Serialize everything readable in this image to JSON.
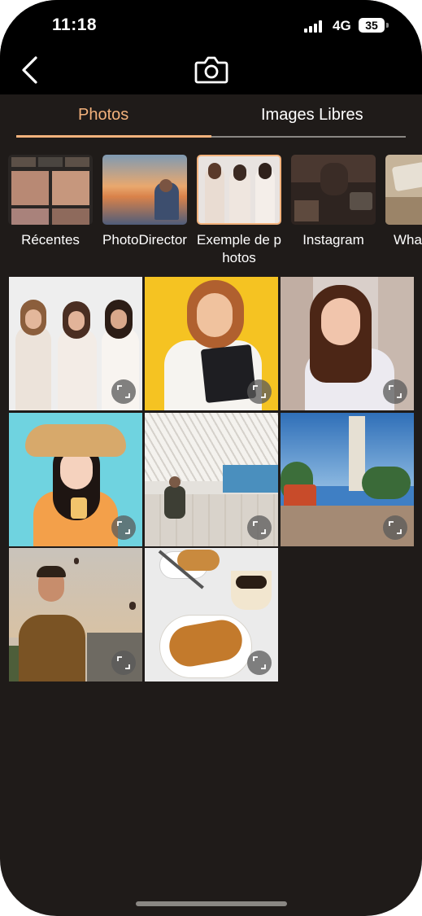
{
  "status_bar": {
    "time": "11:18",
    "network": "4G",
    "battery": "35"
  },
  "header": {
    "back_icon": "chevron-left-icon",
    "camera_icon": "camera-icon"
  },
  "tabs": [
    {
      "label": "Photos",
      "active": true
    },
    {
      "label": "Images Libres",
      "active": false
    }
  ],
  "albums": [
    {
      "label": "Récentes"
    },
    {
      "label": "PhotoDirector"
    },
    {
      "label": "Exemple de photos",
      "selected": true
    },
    {
      "label": "Instagram"
    },
    {
      "label": "Wha"
    }
  ],
  "photos": [
    {
      "subject": "three women"
    },
    {
      "subject": "woman with folders"
    },
    {
      "subject": "woman in white"
    },
    {
      "subject": "woman with straw hat"
    },
    {
      "subject": "man seated by white building"
    },
    {
      "subject": "street with tram"
    },
    {
      "subject": "man with balloons"
    },
    {
      "subject": "croissant and coffee"
    }
  ],
  "colors": {
    "accent": "#f3b27c",
    "background": "#1f1b19",
    "bar": "#000000"
  }
}
